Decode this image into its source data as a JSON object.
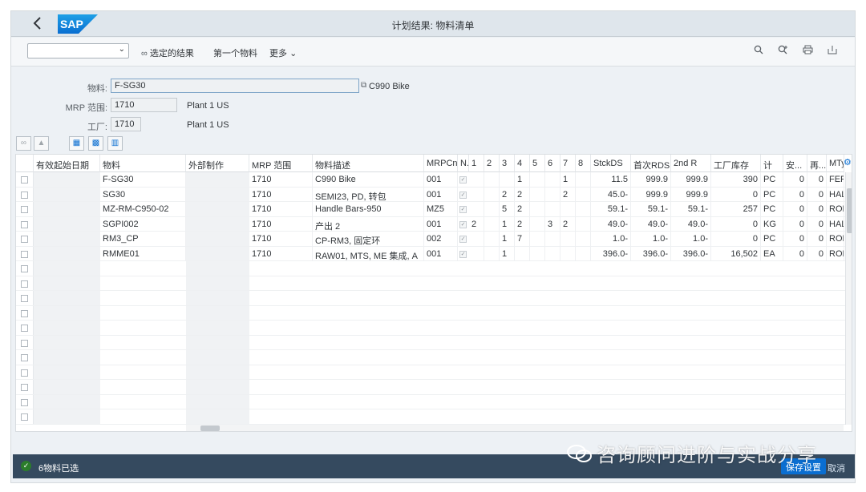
{
  "shell": {
    "title": "计划结果: 物料清单",
    "logo": "SAP",
    "back_icon": "chevron-left-icon"
  },
  "toolbar": {
    "variant_value": "",
    "selected_results": "选定的结果",
    "first_material": "第一个物料",
    "more": "更多"
  },
  "header": {
    "material_label": "物料:",
    "material_value": "F-SG30",
    "material_desc": "C990 Bike",
    "mrp_area_label": "MRP 范围:",
    "mrp_area_value": "1710",
    "mrp_area_desc": "Plant 1 US",
    "plant_label": "工厂:",
    "plant_value": "1710",
    "plant_desc": "Plant 1 US"
  },
  "table": {
    "columns": [
      "有效起始日期",
      "物料",
      "外部制作",
      "MRP 范围",
      "物料描述",
      "MRPCn",
      "N.",
      "1",
      "2",
      "3",
      "4",
      "5",
      "6",
      "7",
      "8",
      "StckDS",
      "首次RDS",
      "2nd R",
      "工厂库存",
      "计",
      "安...",
      "再...",
      "MTyp"
    ],
    "rows": [
      {
        "material": "F-SG30",
        "mrp_area": "1710",
        "desc": "C990 Bike",
        "mrpcn": "001",
        "c1": "",
        "c2": "",
        "c3": "",
        "c4": "1",
        "c5": "",
        "c6": "",
        "c7": "1",
        "c8": "",
        "stckds": "11.5",
        "rds1": "999.9",
        "rds2": "999.9",
        "stock": "390",
        "unit": "PC",
        "safety": "0",
        "reorder": "0",
        "mtyp": "FERT"
      },
      {
        "material": "SG30",
        "mrp_area": "1710",
        "desc": "SEMI23, PD, 转包",
        "mrpcn": "001",
        "c1": "",
        "c2": "",
        "c3": "2",
        "c4": "2",
        "c5": "",
        "c6": "",
        "c7": "2",
        "c8": "",
        "stckds": "45.0-",
        "rds1": "999.9",
        "rds2": "999.9",
        "stock": "0",
        "unit": "PC",
        "safety": "0",
        "reorder": "0",
        "mtyp": "HALB"
      },
      {
        "material": "MZ-RM-C950-02",
        "mrp_area": "1710",
        "desc": "Handle Bars-950",
        "mrpcn": "MZ5",
        "c1": "",
        "c2": "",
        "c3": "5",
        "c4": "2",
        "c5": "",
        "c6": "",
        "c7": "",
        "c8": "",
        "stckds": "59.1-",
        "rds1": "59.1-",
        "rds2": "59.1-",
        "stock": "257",
        "unit": "PC",
        "safety": "0",
        "reorder": "0",
        "mtyp": "ROH"
      },
      {
        "material": "SGPI002",
        "mrp_area": "1710",
        "desc": "产出 2",
        "mrpcn": "001",
        "c1": "2",
        "c2": "",
        "c3": "1",
        "c4": "2",
        "c5": "",
        "c6": "3",
        "c7": "2",
        "c8": "",
        "stckds": "49.0-",
        "rds1": "49.0-",
        "rds2": "49.0-",
        "stock": "0",
        "unit": "KG",
        "safety": "0",
        "reorder": "0",
        "mtyp": "HALB"
      },
      {
        "material": "RM3_CP",
        "mrp_area": "1710",
        "desc": "CP-RM3, 固定环",
        "mrpcn": "002",
        "c1": "",
        "c2": "",
        "c3": "1",
        "c4": "7",
        "c5": "",
        "c6": "",
        "c7": "",
        "c8": "",
        "stckds": "1.0-",
        "rds1": "1.0-",
        "rds2": "1.0-",
        "stock": "0",
        "unit": "PC",
        "safety": "0",
        "reorder": "0",
        "mtyp": "ROH"
      },
      {
        "material": "RMME01",
        "mrp_area": "1710",
        "desc": "RAW01, MTS, ME 集成, A",
        "mrpcn": "001",
        "c1": "",
        "c2": "",
        "c3": "1",
        "c4": "",
        "c5": "",
        "c6": "",
        "c7": "",
        "c8": "",
        "stckds": "396.0-",
        "rds1": "396.0-",
        "rds2": "396.0-",
        "stock": "16,502",
        "unit": "EA",
        "safety": "0",
        "reorder": "0",
        "mtyp": "ROH"
      }
    ]
  },
  "footer": {
    "status_text": "6物料已选",
    "save_label": "保存设置",
    "cancel_label": "取消",
    "watermark": "咨询顾问进阶与实战分享"
  },
  "colors": {
    "shell_bg": "#dfe6ec",
    "footer_bg": "#354a5f",
    "accent": "#0a6ed1",
    "success": "#2b7d2b"
  }
}
